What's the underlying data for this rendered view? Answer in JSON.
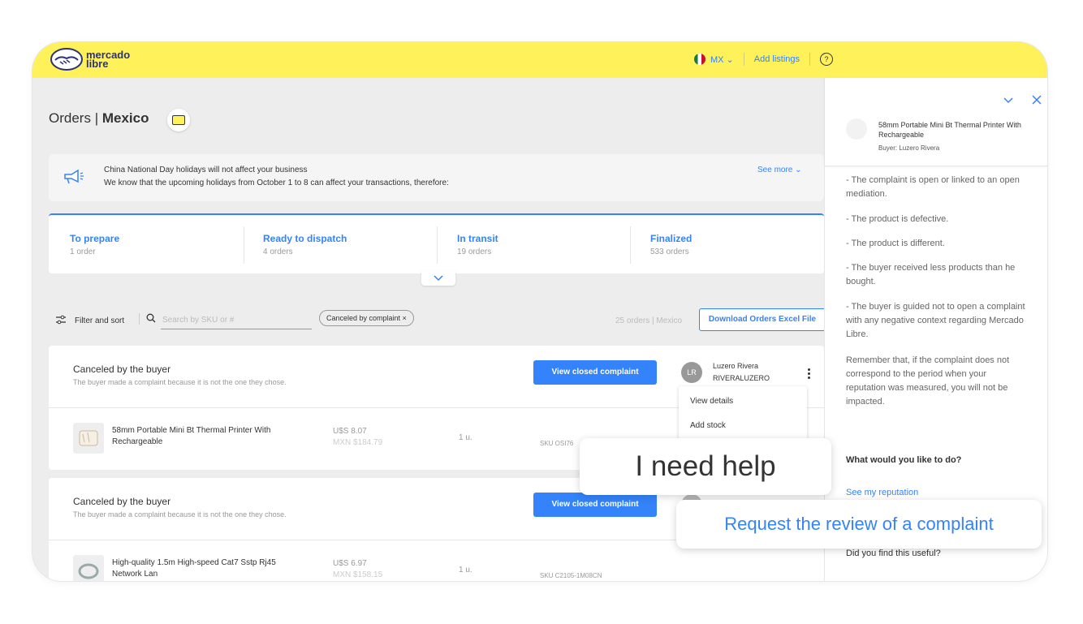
{
  "brand": {
    "logo_line1": "mercado",
    "logo_line2": "libre",
    "accent": "#fff159",
    "link_color": "#3483fa"
  },
  "topbar": {
    "country": "MX",
    "add_listings": "Add listings",
    "help": "?"
  },
  "page": {
    "title_prefix": "Orders",
    "title_sep": " | ",
    "title_country": "Mexico"
  },
  "notice": {
    "line1": "China National Day holidays will not affect your business",
    "line2": "We know that the upcoming holidays from October 1 to 8 can affect your transactions, therefore:",
    "see_more": "See more"
  },
  "tabs": [
    {
      "label": "To prepare",
      "count": "1 order"
    },
    {
      "label": "Ready to dispatch",
      "count": "4 orders"
    },
    {
      "label": "In transit",
      "count": "19 orders"
    },
    {
      "label": "Finalized",
      "count": "533 orders"
    }
  ],
  "filters": {
    "filter_label": "Filter and sort",
    "search_placeholder": "Search by SKU or #",
    "chip": "Canceled by complaint ×",
    "orders_count": "25 orders | Mexico",
    "download": "Download Orders Excel File"
  },
  "orders": [
    {
      "status": "Canceled by the buyer",
      "subtitle": "The buyer made a complaint because it is not the one they chose.",
      "button": "View closed complaint",
      "avatar": "LR",
      "buyer_name": "Luzero Rivera",
      "buyer_nick": "RIVERALUZERO",
      "product": "58mm Portable Mini Bt Thermal Printer With Rechargeable",
      "price_usd": "U$S 8.07",
      "price_mxn": "MXN $184.79",
      "qty": "1 u.",
      "sku": "SKU OSI76"
    },
    {
      "status": "Canceled by the buyer",
      "subtitle": "The buyer made a complaint because it is not the one they chose.",
      "button": "View closed complaint",
      "product": "High-quality 1.5m High-speed Cat7 Sstp Rj45 Network Lan",
      "price_usd": "U$S 6.97",
      "price_mxn": "MXN $158.15",
      "qty": "1 u.",
      "sku": "SKU C2105-1M08CN"
    }
  ],
  "menu": {
    "items": [
      "View details",
      "Add stock"
    ]
  },
  "side": {
    "product": "58mm Portable Mini Bt Thermal Printer With Rechargeable",
    "buyer": "Buyer: Luzero Rivera",
    "paragraphs": [
      "- The complaint is open or linked to an open mediation.",
      "- The product is defective.",
      "- The product is different.",
      "- The buyer received less products than he bought.",
      "- The buyer is guided not to open a complaint with any negative context regarding Mercado Libre.",
      "Remember that, if the complaint does not correspond to the period when your reputation was measured, you will not be impacted."
    ],
    "question": "What would you like to do?",
    "link": "See my reputation",
    "useful": "Did you find this useful?"
  },
  "callouts": {
    "help": "I need help",
    "review": "Request the review of a complaint"
  }
}
